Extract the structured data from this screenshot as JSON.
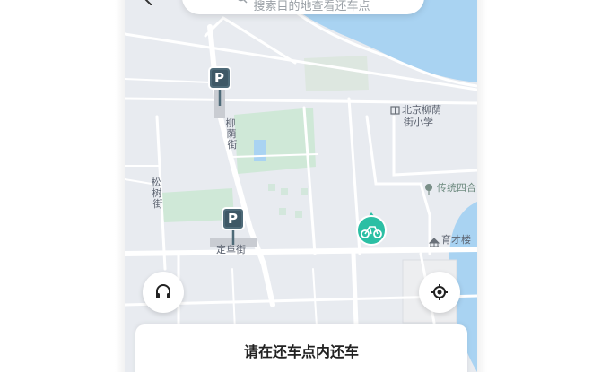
{
  "search": {
    "placeholder": "搜索目的地查看还车点"
  },
  "map": {
    "pois": {
      "school_line1": "北京柳荫",
      "school_line2": "街小学",
      "courtyard": "传统四合",
      "building": "育才楼"
    },
    "streets": {
      "liuyin_1": "柳",
      "liuyin_2": "荫",
      "liuyin_3": "街",
      "songshu_1": "松",
      "songshu_2": "树",
      "songshu_3": "街",
      "dingfu": "定阜街"
    },
    "parking_label": "P"
  },
  "bottom_card": {
    "title": "请在还车点内还车"
  },
  "colors": {
    "water": "#a9d3f2",
    "park": "#cfe8d7",
    "road": "#ffffff",
    "parking": "#4e6a78",
    "bike_station": "#2bbfa4"
  }
}
